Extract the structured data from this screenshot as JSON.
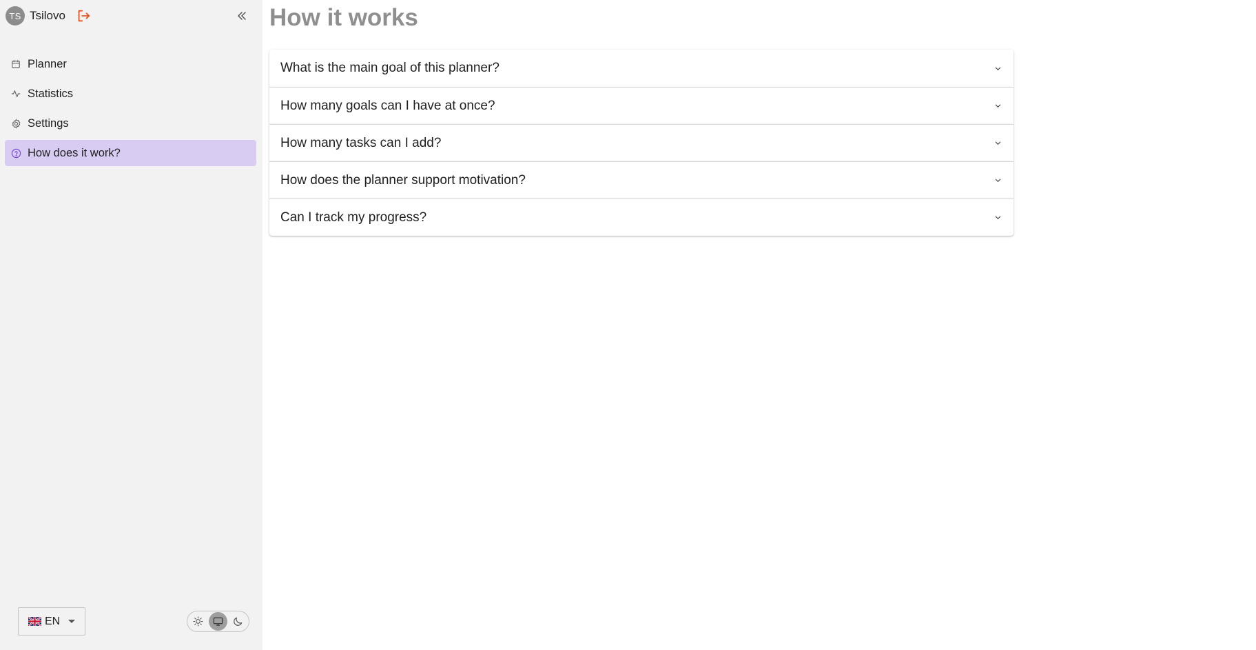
{
  "user": {
    "initials": "TS",
    "name": "Tsilovo"
  },
  "sidebar": {
    "items": [
      {
        "label": "Planner",
        "icon": "calendar-icon",
        "active": false
      },
      {
        "label": "Statistics",
        "icon": "activity-icon",
        "active": false
      },
      {
        "label": "Settings",
        "icon": "gear-icon",
        "active": false
      },
      {
        "label": "How does it work?",
        "icon": "question-circle-icon",
        "active": true
      }
    ]
  },
  "language": {
    "code": "EN",
    "flag": "uk-flag-icon"
  },
  "theme": {
    "options": [
      "light",
      "system",
      "dark"
    ],
    "selected": "system"
  },
  "main": {
    "title": "How it works",
    "faq": [
      {
        "question": "What is the main goal of this planner?"
      },
      {
        "question": "How many goals can I have at once?"
      },
      {
        "question": "How many tasks can I add?"
      },
      {
        "question": "How does the planner support motivation?"
      },
      {
        "question": "Can I track my progress?"
      }
    ]
  },
  "colors": {
    "accent_active_bg": "#d9ccf2",
    "accent_active_icon": "#7c4ddb",
    "logout_icon": "#e8531f",
    "title_gray": "#8f8f8f"
  }
}
